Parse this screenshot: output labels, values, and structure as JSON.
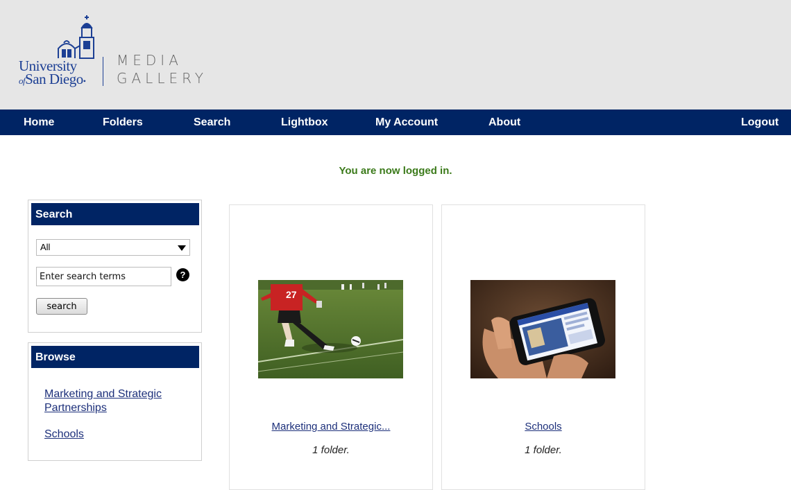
{
  "header": {
    "logo": {
      "line1": "University",
      "of": "of",
      "line2": "San Diego"
    },
    "title_line1": "MEDIA",
    "title_line2": "GALLERY"
  },
  "nav": {
    "items": [
      {
        "label": "Home"
      },
      {
        "label": "Folders"
      },
      {
        "label": "Search"
      },
      {
        "label": "Lightbox"
      },
      {
        "label": "My Account"
      },
      {
        "label": "About"
      }
    ],
    "logout": "Logout"
  },
  "status_message": "You are now logged in.",
  "search_panel": {
    "title": "Search",
    "scope_value": "All",
    "input_placeholder": "Enter search terms",
    "help_symbol": "?",
    "button_label": "search"
  },
  "browse_panel": {
    "title": "Browse",
    "links": [
      {
        "label_line1": "Marketing and Strategic",
        "label_line2": "Partnerships"
      },
      {
        "label": "Schools"
      }
    ]
  },
  "folders": [
    {
      "title": "Marketing and Strategic...",
      "count": "1 folder.",
      "image": "soccer-player-photo"
    },
    {
      "title": "Schools",
      "count": "1 folder.",
      "image": "smartphone-photo"
    }
  ],
  "colors": {
    "nav_bg": "#002464",
    "header_bg": "#e6e6e6",
    "brand_blue": "#1c3f94",
    "status_green": "#3b7a1a",
    "link": "#1c2f7a"
  }
}
